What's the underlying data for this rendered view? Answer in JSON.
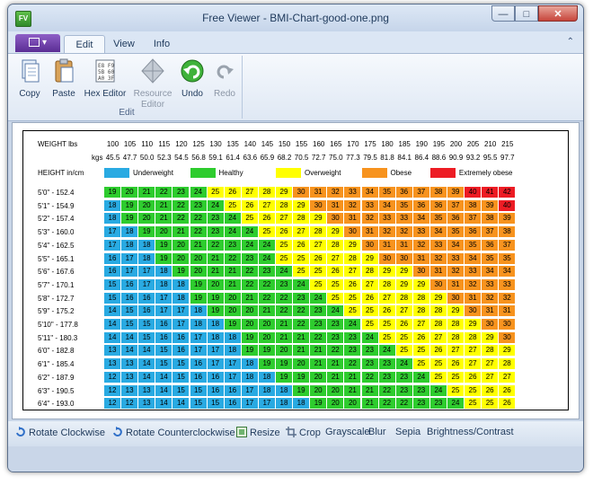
{
  "window": {
    "title": "Free Viewer - BMI-Chart-good-one.png",
    "app_icon": "FV"
  },
  "tabs": [
    {
      "label": "Edit",
      "active": true
    },
    {
      "label": "View",
      "active": false
    },
    {
      "label": "Info",
      "active": false
    }
  ],
  "ribbon": {
    "group_label": "Edit",
    "buttons": [
      {
        "label": "Copy",
        "icon": "copy-icon",
        "enabled": true
      },
      {
        "label": "Paste",
        "icon": "paste-icon",
        "enabled": true
      },
      {
        "label": "Hex Editor",
        "icon": "hex-editor-icon",
        "enabled": true
      },
      {
        "label": "Resource Editor",
        "icon": "resource-editor-icon",
        "enabled": false
      },
      {
        "label": "Undo",
        "icon": "undo-icon",
        "enabled": true
      },
      {
        "label": "Redo",
        "icon": "redo-icon",
        "enabled": false
      }
    ]
  },
  "bmi_chart": {
    "weight_label": "WEIGHT lbs",
    "kgs_label": "kgs",
    "height_label": "HEIGHT in/cm",
    "weights_lbs": [
      "100",
      "105",
      "110",
      "115",
      "120",
      "125",
      "130",
      "135",
      "140",
      "145",
      "150",
      "155",
      "160",
      "165",
      "170",
      "175",
      "180",
      "185",
      "190",
      "195",
      "200",
      "205",
      "210",
      "215"
    ],
    "weights_kgs": [
      "45.5",
      "47.7",
      "50.0",
      "52.3",
      "54.5",
      "56.8",
      "59.1",
      "61.4",
      "63.6",
      "65.9",
      "68.2",
      "70.5",
      "72.7",
      "75.0",
      "77.3",
      "79.5",
      "81.8",
      "84.1",
      "86.4",
      "88.6",
      "90.9",
      "93.2",
      "95.5",
      "97.7"
    ],
    "legend": [
      {
        "label": "Underweight",
        "color": "#29aae2"
      },
      {
        "label": "Healthy",
        "color": "#2ecc2e"
      },
      {
        "label": "Overweight",
        "color": "#ffff00"
      },
      {
        "label": "Obese",
        "color": "#f7931e"
      },
      {
        "label": "Extremely obese",
        "color": "#ed1c24"
      }
    ],
    "heights": [
      "5'0\"  -  152.4",
      "5'1\"  -  154.9",
      "5'2\"  -  157.4",
      "5'3\"  -  160.0",
      "5'4\"  -  162.5",
      "5'5\"  -  165.1",
      "5'6\"  -  167.6",
      "5'7\"  -  170.1",
      "5'8\"  -  172.7",
      "5'9\"  -  175.2",
      "5'10\" - 177.8",
      "5'11\" - 180.3",
      "6'0\"  -  182.8",
      "6'1\"  -  185.4",
      "6'2\"  -  187.9",
      "6'3\"  -  190.5",
      "6'4\"  -  193.0"
    ],
    "rows": [
      [
        "19",
        "20",
        "21",
        "22",
        "23",
        "24",
        "25",
        "26",
        "27",
        "28",
        "29",
        "30",
        "31",
        "32",
        "33",
        "34",
        "35",
        "36",
        "37",
        "38",
        "39",
        "40",
        "41",
        "42"
      ],
      [
        "18",
        "19",
        "20",
        "21",
        "22",
        "23",
        "24",
        "25",
        "26",
        "27",
        "28",
        "29",
        "30",
        "31",
        "32",
        "33",
        "34",
        "35",
        "36",
        "36",
        "37",
        "38",
        "39",
        "40"
      ],
      [
        "18",
        "19",
        "20",
        "21",
        "22",
        "22",
        "23",
        "24",
        "25",
        "26",
        "27",
        "28",
        "29",
        "30",
        "31",
        "32",
        "33",
        "33",
        "34",
        "35",
        "36",
        "37",
        "38",
        "39"
      ],
      [
        "17",
        "18",
        "19",
        "20",
        "21",
        "22",
        "23",
        "24",
        "24",
        "25",
        "26",
        "27",
        "28",
        "29",
        "30",
        "31",
        "32",
        "32",
        "33",
        "34",
        "35",
        "36",
        "37",
        "38"
      ],
      [
        "17",
        "18",
        "18",
        "19",
        "20",
        "21",
        "22",
        "23",
        "24",
        "24",
        "25",
        "26",
        "27",
        "28",
        "29",
        "30",
        "31",
        "31",
        "32",
        "33",
        "34",
        "35",
        "36",
        "37"
      ],
      [
        "16",
        "17",
        "18",
        "19",
        "20",
        "20",
        "21",
        "22",
        "23",
        "24",
        "25",
        "25",
        "26",
        "27",
        "28",
        "29",
        "30",
        "30",
        "31",
        "32",
        "33",
        "34",
        "35",
        "35"
      ],
      [
        "16",
        "17",
        "17",
        "18",
        "19",
        "20",
        "21",
        "21",
        "22",
        "23",
        "24",
        "25",
        "25",
        "26",
        "27",
        "28",
        "29",
        "29",
        "30",
        "31",
        "32",
        "33",
        "34",
        "34"
      ],
      [
        "15",
        "16",
        "17",
        "18",
        "18",
        "19",
        "20",
        "21",
        "22",
        "22",
        "23",
        "24",
        "25",
        "25",
        "26",
        "27",
        "28",
        "29",
        "29",
        "30",
        "31",
        "32",
        "33",
        "33"
      ],
      [
        "15",
        "16",
        "16",
        "17",
        "18",
        "19",
        "19",
        "20",
        "21",
        "22",
        "22",
        "23",
        "24",
        "25",
        "25",
        "26",
        "27",
        "28",
        "28",
        "29",
        "30",
        "31",
        "32",
        "32"
      ],
      [
        "14",
        "15",
        "16",
        "17",
        "17",
        "18",
        "19",
        "20",
        "20",
        "21",
        "22",
        "22",
        "23",
        "24",
        "25",
        "25",
        "26",
        "27",
        "28",
        "28",
        "29",
        "30",
        "31",
        "31"
      ],
      [
        "14",
        "15",
        "15",
        "16",
        "17",
        "18",
        "18",
        "19",
        "20",
        "20",
        "21",
        "22",
        "23",
        "23",
        "24",
        "25",
        "25",
        "26",
        "27",
        "28",
        "28",
        "29",
        "30",
        "30"
      ],
      [
        "14",
        "14",
        "15",
        "16",
        "16",
        "17",
        "18",
        "18",
        "19",
        "20",
        "21",
        "21",
        "22",
        "23",
        "23",
        "24",
        "25",
        "25",
        "26",
        "27",
        "28",
        "28",
        "29",
        "30"
      ],
      [
        "13",
        "14",
        "14",
        "15",
        "16",
        "17",
        "17",
        "18",
        "19",
        "19",
        "20",
        "21",
        "21",
        "22",
        "23",
        "23",
        "24",
        "25",
        "25",
        "26",
        "27",
        "27",
        "28",
        "29"
      ],
      [
        "13",
        "13",
        "14",
        "15",
        "15",
        "16",
        "17",
        "17",
        "18",
        "19",
        "19",
        "20",
        "21",
        "21",
        "22",
        "23",
        "23",
        "24",
        "25",
        "25",
        "26",
        "27",
        "27",
        "28"
      ],
      [
        "12",
        "13",
        "14",
        "14",
        "15",
        "16",
        "16",
        "17",
        "18",
        "18",
        "19",
        "19",
        "20",
        "21",
        "21",
        "22",
        "23",
        "23",
        "24",
        "25",
        "25",
        "26",
        "27",
        "27"
      ],
      [
        "12",
        "13",
        "13",
        "14",
        "15",
        "15",
        "16",
        "16",
        "17",
        "18",
        "18",
        "19",
        "20",
        "20",
        "21",
        "21",
        "22",
        "23",
        "23",
        "24",
        "25",
        "25",
        "26",
        "26"
      ],
      [
        "12",
        "12",
        "13",
        "14",
        "14",
        "15",
        "15",
        "16",
        "17",
        "17",
        "18",
        "18",
        "19",
        "20",
        "20",
        "21",
        "22",
        "22",
        "23",
        "23",
        "24",
        "25",
        "25",
        "26"
      ]
    ]
  },
  "toolbar": [
    {
      "label": "Rotate Clockwise",
      "icon": "rotate-clockwise-icon"
    },
    {
      "label": "Rotate Counterclockwise",
      "icon": "rotate-counterclockwise-icon"
    },
    {
      "label": "Resize",
      "icon": "resize-icon"
    },
    {
      "label": "Crop",
      "icon": "crop-icon"
    },
    {
      "label": "Grayscale",
      "icon": ""
    },
    {
      "label": "Blur",
      "icon": ""
    },
    {
      "label": "Sepia",
      "icon": ""
    },
    {
      "label": "Brightness/Contrast",
      "icon": ""
    }
  ]
}
